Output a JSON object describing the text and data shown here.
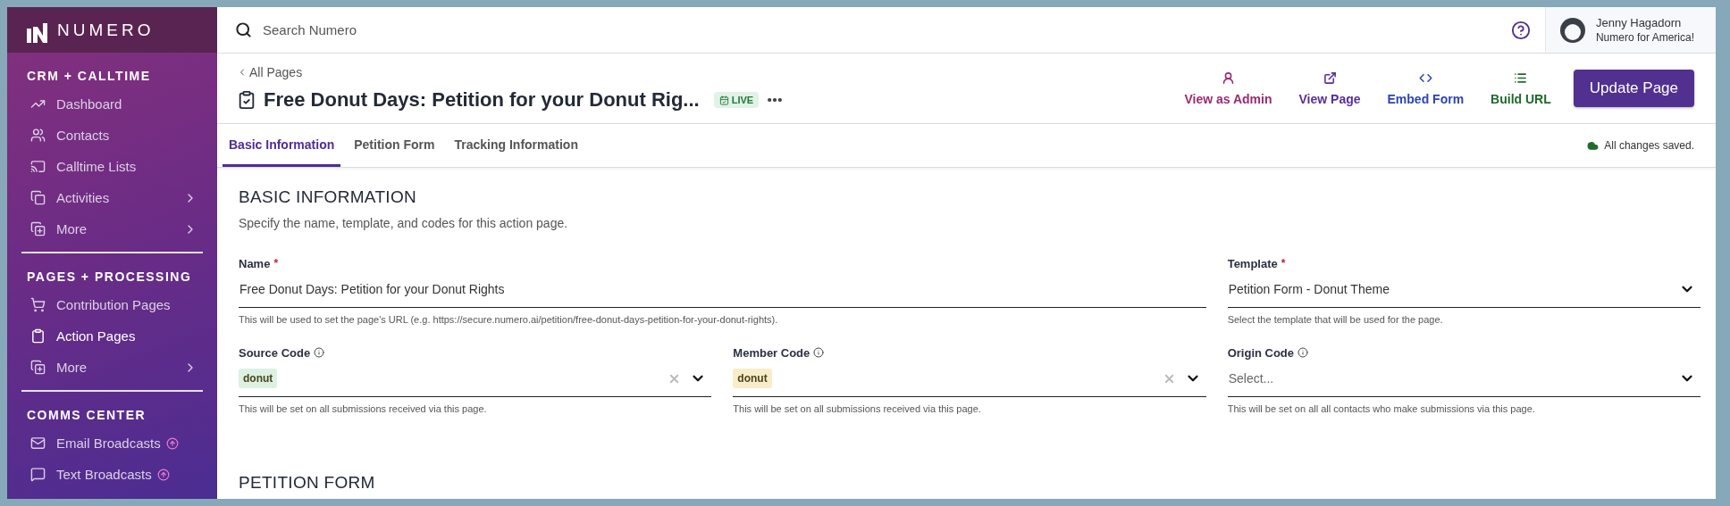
{
  "logo": {
    "text": "NUMERO"
  },
  "sidebar": {
    "sections": [
      {
        "title": "CRM + CALLTIME",
        "items": [
          {
            "label": "Dashboard",
            "selected": false,
            "has_submenu": false,
            "upgrade": false
          },
          {
            "label": "Contacts",
            "selected": false,
            "has_submenu": false,
            "upgrade": false
          },
          {
            "label": "Calltime Lists",
            "selected": false,
            "has_submenu": false,
            "upgrade": false
          },
          {
            "label": "Activities",
            "selected": false,
            "has_submenu": true,
            "upgrade": false
          },
          {
            "label": "More",
            "selected": false,
            "has_submenu": true,
            "upgrade": false
          }
        ]
      },
      {
        "title": "PAGES + PROCESSING",
        "items": [
          {
            "label": "Contribution Pages",
            "selected": false,
            "has_submenu": false,
            "upgrade": false
          },
          {
            "label": "Action Pages",
            "selected": true,
            "has_submenu": false,
            "upgrade": false
          },
          {
            "label": "More",
            "selected": false,
            "has_submenu": true,
            "upgrade": false
          }
        ]
      },
      {
        "title": "COMMS CENTER",
        "items": [
          {
            "label": "Email Broadcasts",
            "selected": false,
            "has_submenu": false,
            "upgrade": true
          },
          {
            "label": "Text Broadcasts",
            "selected": false,
            "has_submenu": false,
            "upgrade": true
          }
        ]
      }
    ]
  },
  "topbar": {
    "search": {
      "placeholder": "Search Numero"
    },
    "user": {
      "name": "Jenny Hagadorn",
      "organization": "Numero for America!"
    }
  },
  "header": {
    "back_link": "All Pages",
    "title": "Free Donut Days: Petition for your Donut Rig...",
    "status": "LIVE",
    "actions": [
      {
        "label": "View as Admin",
        "color": "#9b2b6f"
      },
      {
        "label": "View Page",
        "color": "#5a2d98"
      },
      {
        "label": "Embed Form",
        "color": "#2c45b5"
      },
      {
        "label": "Build URL",
        "color": "#1f6a2c"
      }
    ],
    "primary_button": "Update Page"
  },
  "tabs": [
    {
      "label": "Basic Information",
      "selected": true
    },
    {
      "label": "Petition Form",
      "selected": false
    },
    {
      "label": "Tracking Information",
      "selected": false
    }
  ],
  "save_status": "All changes saved.",
  "section": {
    "title": "BASIC INFORMATION",
    "description": "Specify the name, template, and codes for this action page.",
    "fields": [
      {
        "kind": "text",
        "label": "Name",
        "required_mark": "*",
        "value": "Free Donut Days: Petition for your Donut Rights",
        "help": "This will be used to set the page's URL (e.g. https://secure.numero.ai/petition/free-donut-days-petition-for-your-donut-rights)."
      },
      {
        "kind": "select",
        "label": "Template",
        "required_mark": "*",
        "value": "Petition Form - Donut Theme",
        "help": "Select the template that will be used for the page."
      },
      {
        "kind": "tag",
        "label": "Source Code",
        "info": true,
        "tag": "donut",
        "color": "#dcf1e2",
        "help": "This will be set on all submissions received via this page."
      },
      {
        "kind": "tag",
        "label": "Member Code",
        "info": true,
        "tag": "donut",
        "color": "#f8edc8",
        "help": "This will be set on all submissions received via this page."
      },
      {
        "kind": "select",
        "label": "Origin Code",
        "info": true,
        "placeholder": "Select...",
        "help": "This will be set on all all contacts who make submissions via this page."
      }
    ]
  },
  "next_section": {
    "title": "PETITION FORM"
  }
}
